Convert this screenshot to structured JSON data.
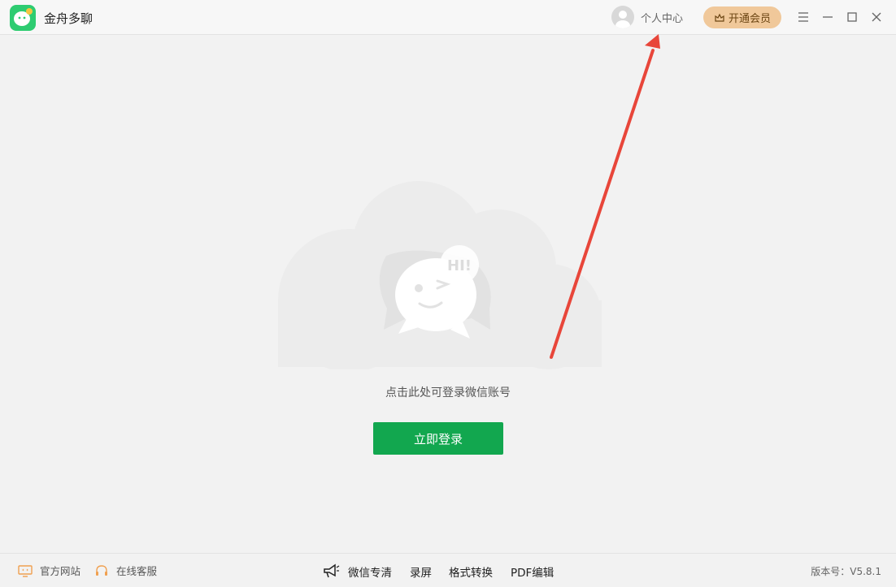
{
  "app": {
    "title": "金舟多聊"
  },
  "header": {
    "user_center_label": "个人中心",
    "vip_label": "开通会员"
  },
  "main": {
    "bubble_text": "HI!",
    "prompt": "点击此处可登录微信账号",
    "login_button": "立即登录"
  },
  "footer": {
    "links": [
      "官方网站",
      "在线客服"
    ],
    "tools": [
      "微信专清",
      "录屏",
      "格式转换",
      "PDF编辑"
    ],
    "version": "版本号：V5.8.1"
  },
  "colors": {
    "brand_green": "#12a74f",
    "vip_gold": "#f0c89a",
    "annotation_red": "#e8463a"
  }
}
